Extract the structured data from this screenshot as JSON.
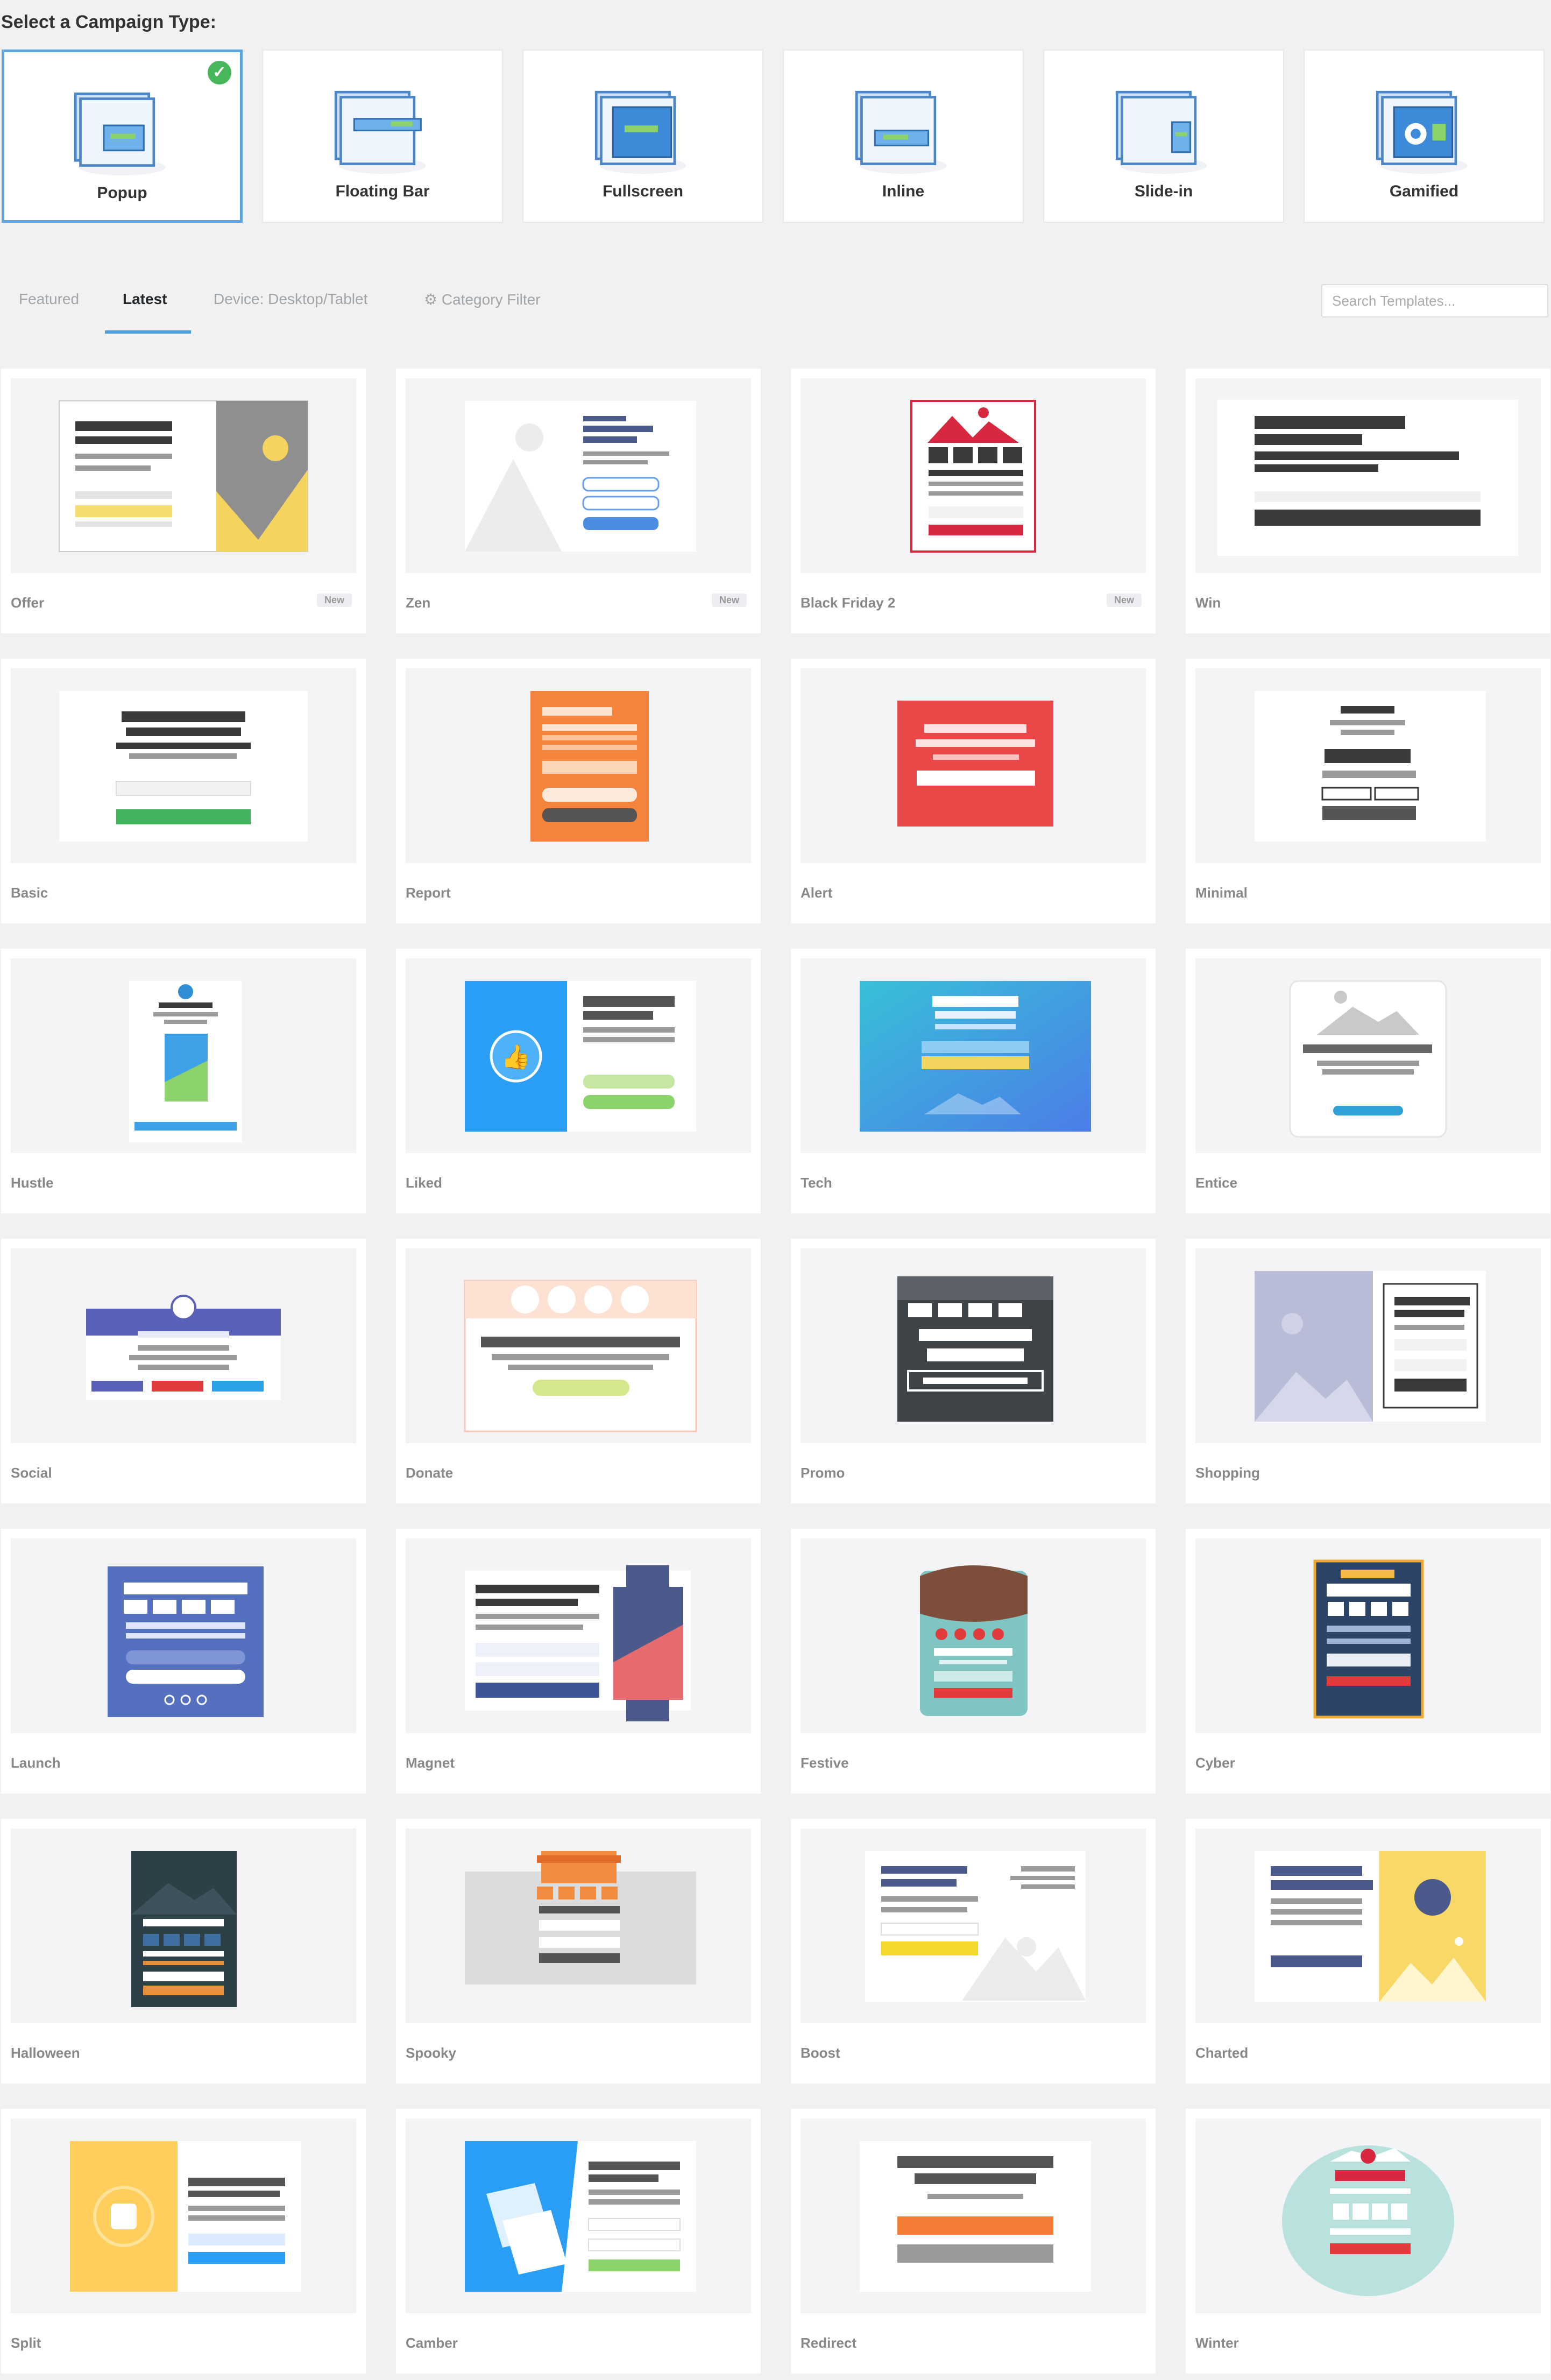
{
  "campaign_types": {
    "title": "Select a Campaign Type:",
    "items": [
      {
        "label": "Popup",
        "selected": true,
        "icon": "popup-icon"
      },
      {
        "label": "Floating Bar",
        "selected": false,
        "icon": "floating-bar-icon"
      },
      {
        "label": "Fullscreen",
        "selected": false,
        "icon": "fullscreen-icon"
      },
      {
        "label": "Inline",
        "selected": false,
        "icon": "inline-icon"
      },
      {
        "label": "Slide-in",
        "selected": false,
        "icon": "slide-in-icon"
      },
      {
        "label": "Gamified",
        "selected": false,
        "icon": "gamified-icon"
      }
    ]
  },
  "tabs": {
    "featured": "Featured",
    "latest": "Latest",
    "device": "Device: Desktop/Tablet",
    "category": "Category Filter",
    "active": "latest"
  },
  "search": {
    "placeholder": "Search Templates..."
  },
  "templates": [
    {
      "name": "Offer",
      "badge": "New",
      "style": "offer"
    },
    {
      "name": "Zen",
      "badge": "New",
      "style": "zen"
    },
    {
      "name": "Black Friday 2",
      "badge": "New",
      "style": "blackfriday"
    },
    {
      "name": "Win",
      "badge": "",
      "style": "win"
    },
    {
      "name": "Basic",
      "badge": "",
      "style": "basic"
    },
    {
      "name": "Report",
      "badge": "",
      "style": "report"
    },
    {
      "name": "Alert",
      "badge": "",
      "style": "alert"
    },
    {
      "name": "Minimal",
      "badge": "",
      "style": "minimal"
    },
    {
      "name": "Hustle",
      "badge": "",
      "style": "hustle"
    },
    {
      "name": "Liked",
      "badge": "",
      "style": "liked"
    },
    {
      "name": "Tech",
      "badge": "",
      "style": "tech"
    },
    {
      "name": "Entice",
      "badge": "",
      "style": "entice"
    },
    {
      "name": "Social",
      "badge": "",
      "style": "social"
    },
    {
      "name": "Donate",
      "badge": "",
      "style": "donate"
    },
    {
      "name": "Promo",
      "badge": "",
      "style": "promo"
    },
    {
      "name": "Shopping",
      "badge": "",
      "style": "shopping"
    },
    {
      "name": "Launch",
      "badge": "",
      "style": "launch"
    },
    {
      "name": "Magnet",
      "badge": "",
      "style": "magnet"
    },
    {
      "name": "Festive",
      "badge": "",
      "style": "festive"
    },
    {
      "name": "Cyber",
      "badge": "",
      "style": "cyber"
    },
    {
      "name": "Halloween",
      "badge": "",
      "style": "halloween"
    },
    {
      "name": "Spooky",
      "badge": "",
      "style": "spooky"
    },
    {
      "name": "Boost",
      "badge": "",
      "style": "boost"
    },
    {
      "name": "Charted",
      "badge": "",
      "style": "charted"
    },
    {
      "name": "Split",
      "badge": "",
      "style": "split"
    },
    {
      "name": "Camber",
      "badge": "",
      "style": "camber"
    },
    {
      "name": "Redirect",
      "badge": "",
      "style": "redirect"
    },
    {
      "name": "Winter",
      "badge": "",
      "style": "winter"
    }
  ],
  "colors": {
    "accent": "#4a9fe0",
    "selected_border": "#5ba4e0",
    "check": "#48b65a"
  }
}
